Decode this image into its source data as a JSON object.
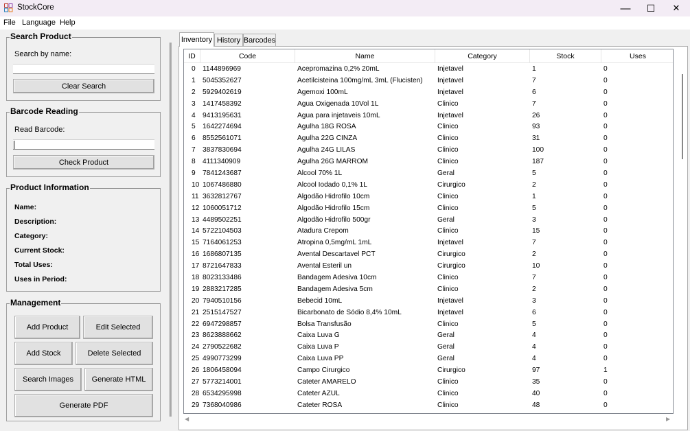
{
  "app": {
    "title": "StockCore",
    "window_controls": {
      "minimize": "—",
      "maximize": "☐",
      "close": "✕"
    }
  },
  "menu": [
    "File",
    "Language",
    "Help"
  ],
  "search_product": {
    "title": "Search Product",
    "label": "Search by name:",
    "value": "",
    "clear_button": "Clear Search"
  },
  "barcode_reading": {
    "title": "Barcode Reading",
    "label": "Read Barcode:",
    "value": "",
    "check_button": "Check Product"
  },
  "product_info": {
    "title": "Product Information",
    "fields": [
      "Name:",
      "Description:",
      "Category:",
      "Current Stock:",
      "Total Uses:",
      "Uses in Period:"
    ]
  },
  "management": {
    "title": "Management",
    "add_product": "Add Product",
    "edit_selected": "Edit Selected",
    "add_stock": "Add Stock",
    "delete_selected": "Delete Selected",
    "search_images": "Search Images",
    "generate_html": "Generate HTML",
    "generate_pdf": "Generate PDF"
  },
  "tabs": [
    "Inventory",
    "History",
    "Barcodes"
  ],
  "table": {
    "columns": [
      "ID",
      "Code",
      "Name",
      "Category",
      "Stock",
      "Uses"
    ],
    "rows": [
      [
        "0",
        "1144896969",
        "Acepromazina 0,2% 20mL",
        "Injetavel",
        "1",
        "0"
      ],
      [
        "1",
        "5045352627",
        "Acetilcisteina 100mg/mL 3mL (Flucisten)",
        "Injetavel",
        "7",
        "0"
      ],
      [
        "2",
        "5929402619",
        "Agemoxi 100mL",
        "Injetavel",
        "6",
        "0"
      ],
      [
        "3",
        "1417458392",
        "Agua Oxigenada 10Vol 1L",
        "Clinico",
        "7",
        "0"
      ],
      [
        "4",
        "9413195631",
        "Agua para injetaveis 10mL",
        "Injetavel",
        "26",
        "0"
      ],
      [
        "5",
        "1642274694",
        "Agulha 18G ROSA",
        "Clinico",
        "93",
        "0"
      ],
      [
        "6",
        "8552561071",
        "Agulha 22G CINZA",
        "Clinico",
        "31",
        "0"
      ],
      [
        "7",
        "3837830694",
        "Agulha 24G LILAS",
        "Clinico",
        "100",
        "0"
      ],
      [
        "8",
        "4111340909",
        "Agulha 26G MARROM",
        "Clinico",
        "187",
        "0"
      ],
      [
        "9",
        "7841243687",
        "Alcool 70% 1L",
        "Geral",
        "5",
        "0"
      ],
      [
        "10",
        "1067486880",
        "Alcool Iodado 0,1% 1L",
        "Cirurgico",
        "2",
        "0"
      ],
      [
        "11",
        "3632812767",
        "Algodão Hidrofilo 10cm",
        "Clinico",
        "1",
        "0"
      ],
      [
        "12",
        "1060051712",
        "Algodão Hidrofilo 15cm",
        "Clinico",
        "5",
        "0"
      ],
      [
        "13",
        "4489502251",
        "Algodão Hidrofilo 500gr",
        "Geral",
        "3",
        "0"
      ],
      [
        "14",
        "5722104503",
        "Atadura Crepom",
        "Clinico",
        "15",
        "0"
      ],
      [
        "15",
        "7164061253",
        "Atropina 0,5mg/mL 1mL",
        "Injetavel",
        "7",
        "0"
      ],
      [
        "16",
        "1686807135",
        "Avental Descartavel PCT",
        "Cirurgico",
        "2",
        "0"
      ],
      [
        "17",
        "8721647833",
        "Avental Esteril un",
        "Cirurgico",
        "10",
        "0"
      ],
      [
        "18",
        "8023133486",
        "Bandagem Adesiva 10cm",
        "Clinico",
        "7",
        "0"
      ],
      [
        "19",
        "2883217285",
        "Bandagem Adesiva 5cm",
        "Clinico",
        "2",
        "0"
      ],
      [
        "20",
        "7940510156",
        "Bebecid 10mL",
        "Injetavel",
        "3",
        "0"
      ],
      [
        "21",
        "2515147527",
        "Bicarbonato de Sódio 8,4% 10mL",
        "Injetavel",
        "6",
        "0"
      ],
      [
        "22",
        "6947298857",
        "Bolsa Transfusão",
        "Clinico",
        "5",
        "0"
      ],
      [
        "23",
        "8623888662",
        "Caixa Luva G",
        "Geral",
        "4",
        "0"
      ],
      [
        "24",
        "2790522682",
        "Caixa Luva P",
        "Geral",
        "4",
        "0"
      ],
      [
        "25",
        "4990773299",
        "Caixa Luva PP",
        "Geral",
        "4",
        "0"
      ],
      [
        "26",
        "1806458094",
        "Campo Cirurgico",
        "Cirurgico",
        "97",
        "1"
      ],
      [
        "27",
        "5773214001",
        "Cateter AMARELO",
        "Clinico",
        "35",
        "0"
      ],
      [
        "28",
        "6534295998",
        "Cateter AZUL",
        "Clinico",
        "40",
        "0"
      ],
      [
        "29",
        "7368040986",
        "Cateter ROSA",
        "Clinico",
        "48",
        "0"
      ]
    ]
  }
}
